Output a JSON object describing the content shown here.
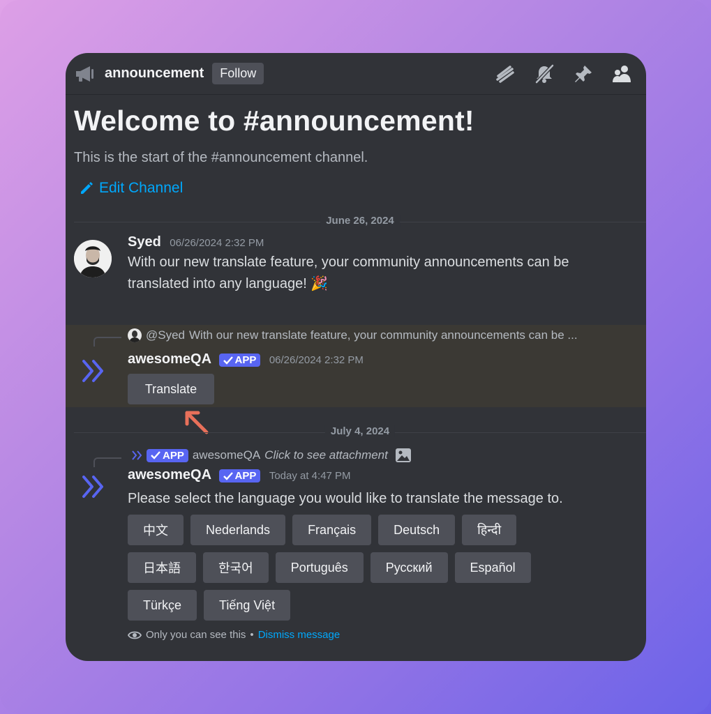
{
  "header": {
    "channel_name": "announcement",
    "follow_label": "Follow",
    "icons": [
      "megaphone-icon",
      "threads-icon",
      "notifications-muted-icon",
      "pin-icon",
      "members-icon"
    ]
  },
  "welcome": {
    "title": "Welcome to #announcement!",
    "subtitle": "This is the start of the #announcement channel.",
    "edit_label": "Edit Channel"
  },
  "dividers": {
    "first": "June 26, 2024",
    "second": "July 4, 2024"
  },
  "message1": {
    "author": "Syed",
    "timestamp": "06/26/2024 2:32 PM",
    "line1": "With our new translate feature, your community announcements can be",
    "line2": "translated into any language! 🎉"
  },
  "message2": {
    "reply_author": "@Syed",
    "reply_text": "With our new translate feature, your community announcements can be ...",
    "author": "awesomeQA",
    "badge": "APP",
    "timestamp": "06/26/2024 2:32 PM",
    "button_label": "Translate"
  },
  "message3": {
    "reply_badge": "APP",
    "reply_author": "awesomeQA",
    "reply_text": "Click to see attachment",
    "author": "awesomeQA",
    "badge": "APP",
    "timestamp": "Today at 4:47 PM",
    "text": "Please select the language you would like to translate the message to.",
    "languages": [
      [
        "中文",
        "Nederlands",
        "Français",
        "Deutsch",
        "हिन्दी"
      ],
      [
        "日本語",
        "한국어",
        "Português",
        "Русский",
        "Español"
      ],
      [
        "Türkçe",
        "Tiếng Việt"
      ]
    ],
    "ephemeral_text": "Only you can see this",
    "separator": "•",
    "dismiss_label": "Dismiss message"
  },
  "colors": {
    "accent": "#5865f2",
    "link": "#00a8fc",
    "annotation_arrow": "#e8705a"
  }
}
